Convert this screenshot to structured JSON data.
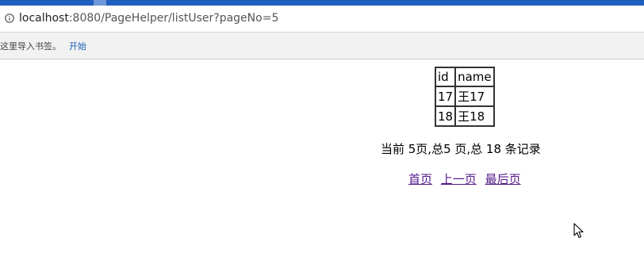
{
  "browser": {
    "url_host": "localhost",
    "url_rest": ":8080/PageHelper/listUser?pageNo=5",
    "bookmarks_hint": "这里导入书签。",
    "bookmarks_start": "开始"
  },
  "table": {
    "headers": [
      "id",
      "name"
    ],
    "rows": [
      [
        "17",
        "王17"
      ],
      [
        "18",
        "王18"
      ]
    ]
  },
  "summary": "当前 5页,总5 页,总 18 条记录",
  "pager": {
    "first": "首页",
    "prev": "上一页",
    "last": "最后页"
  },
  "icons": [
    "info-icon",
    "mouse-cursor-icon"
  ]
}
